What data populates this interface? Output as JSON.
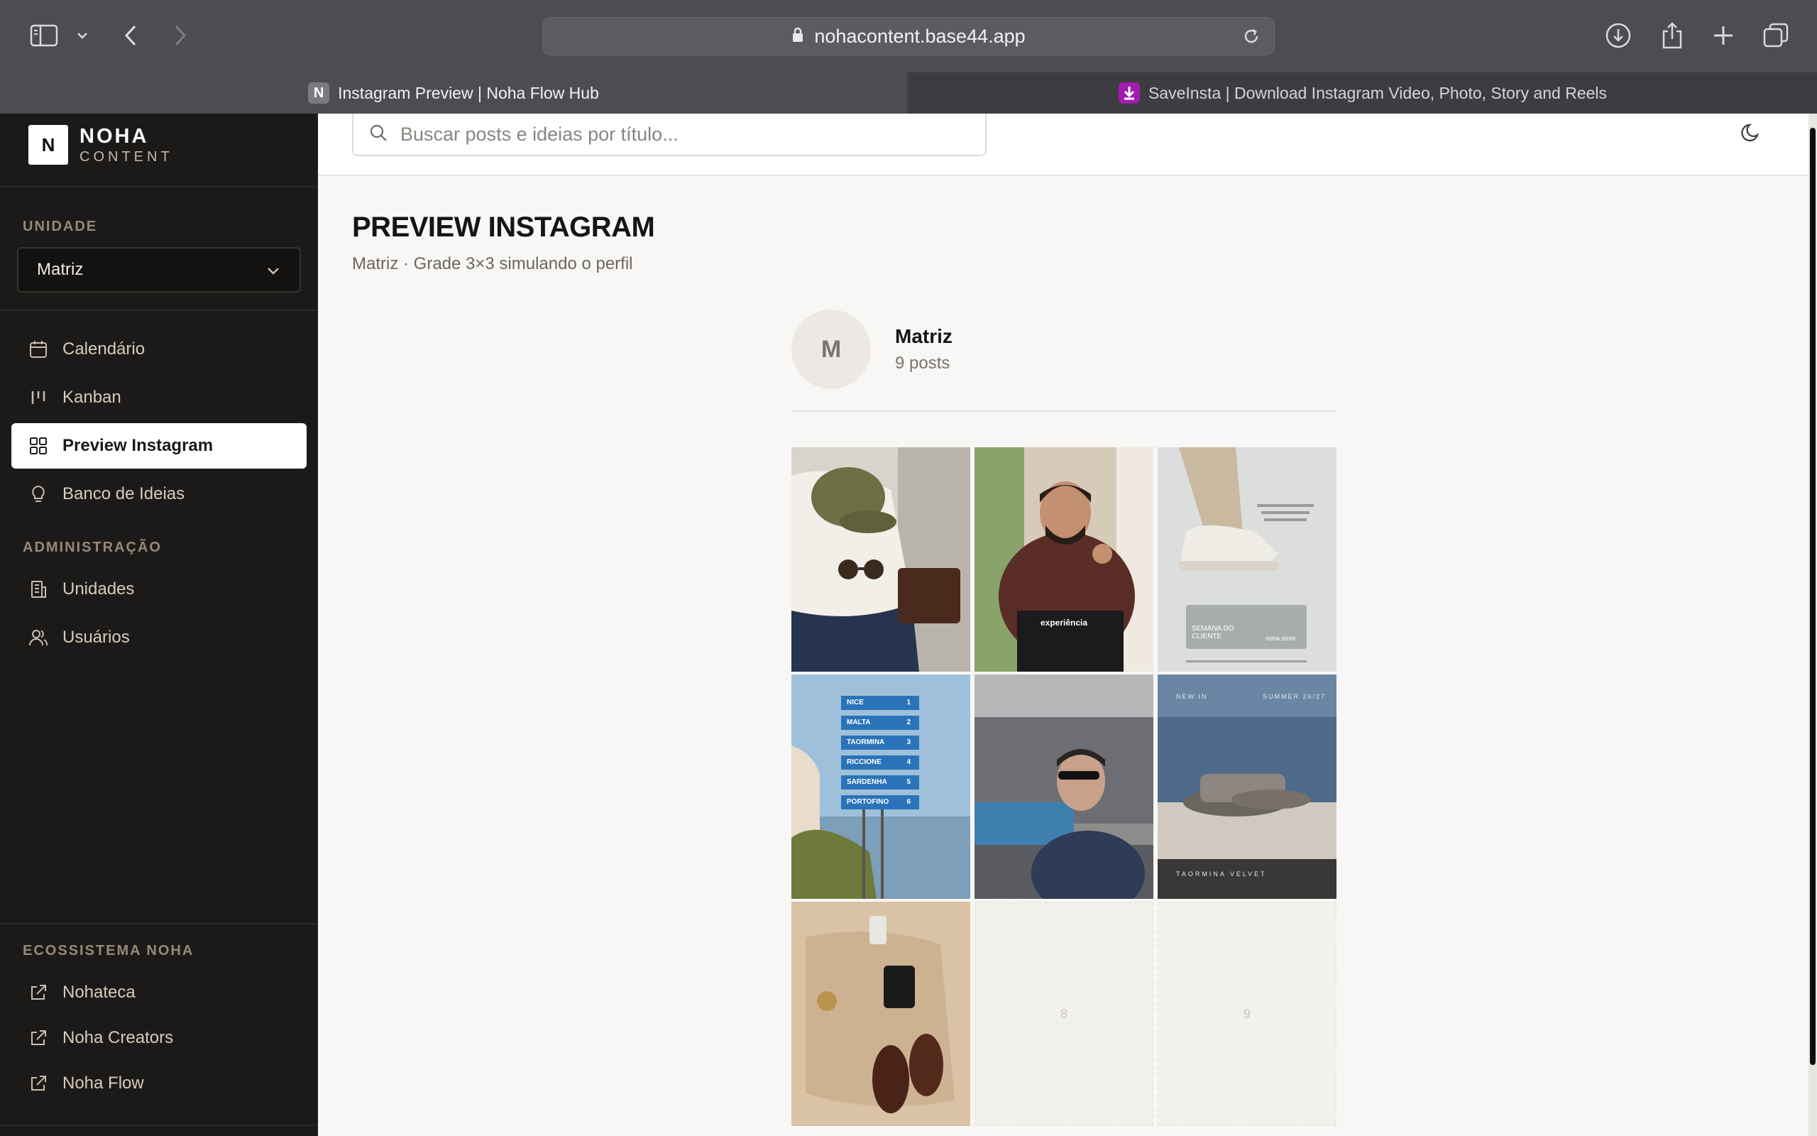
{
  "browser": {
    "url": "nohacontent.base44.app",
    "tabs": [
      {
        "label": "Instagram Preview | Noha Flow Hub",
        "favicon": "N"
      },
      {
        "label": "SaveInsta | Download Instagram Video, Photo, Story and Reels"
      }
    ]
  },
  "brand": {
    "logo_letter": "N",
    "title": "NOHA",
    "subtitle": "CONTENT"
  },
  "sidebar": {
    "unit_section": "UNIDADE",
    "unit_value": "Matriz",
    "items": [
      {
        "label": "Calendário",
        "icon": "calendar-icon"
      },
      {
        "label": "Kanban",
        "icon": "kanban-icon"
      },
      {
        "label": "Preview Instagram",
        "icon": "grid-icon",
        "active": true
      },
      {
        "label": "Banco de Ideias",
        "icon": "lightbulb-icon"
      }
    ],
    "admin_section": "ADMINISTRAÇÃO",
    "admin_items": [
      {
        "label": "Unidades",
        "icon": "building-icon"
      },
      {
        "label": "Usuários",
        "icon": "users-icon"
      }
    ],
    "eco_section": "ECOSSISTEMA NOHA",
    "eco_items": [
      {
        "label": "Nohateca",
        "icon": "external-link-icon"
      },
      {
        "label": "Noha Creators",
        "icon": "external-link-icon"
      },
      {
        "label": "Noha Flow",
        "icon": "external-link-icon"
      }
    ]
  },
  "search": {
    "placeholder": "Buscar posts e ideias por título..."
  },
  "page": {
    "title": "PREVIEW INSTAGRAM",
    "subtitle": "Matriz · Grade 3×3 simulando o perfil"
  },
  "profile": {
    "avatar_letter": "M",
    "name": "Matriz",
    "posts": "9 posts"
  },
  "grid": {
    "post2_text": "experiência",
    "post3_text": "SEMANA DO CLIENTE",
    "post3_brand": "noha.store",
    "post4_signs": [
      "NICE",
      "MALTA",
      "TAORMINA",
      "RICCIONE",
      "SARDENHA",
      "PORTOFINO"
    ],
    "post4_numbers": [
      "1",
      "2",
      "3",
      "4",
      "5",
      "6"
    ],
    "post6_top_left": "NEW IN",
    "post6_top_right": "SUMMER 26/27",
    "post6_bottom": "TAORMINA VELVET",
    "empty_slots": [
      "8",
      "9"
    ]
  }
}
